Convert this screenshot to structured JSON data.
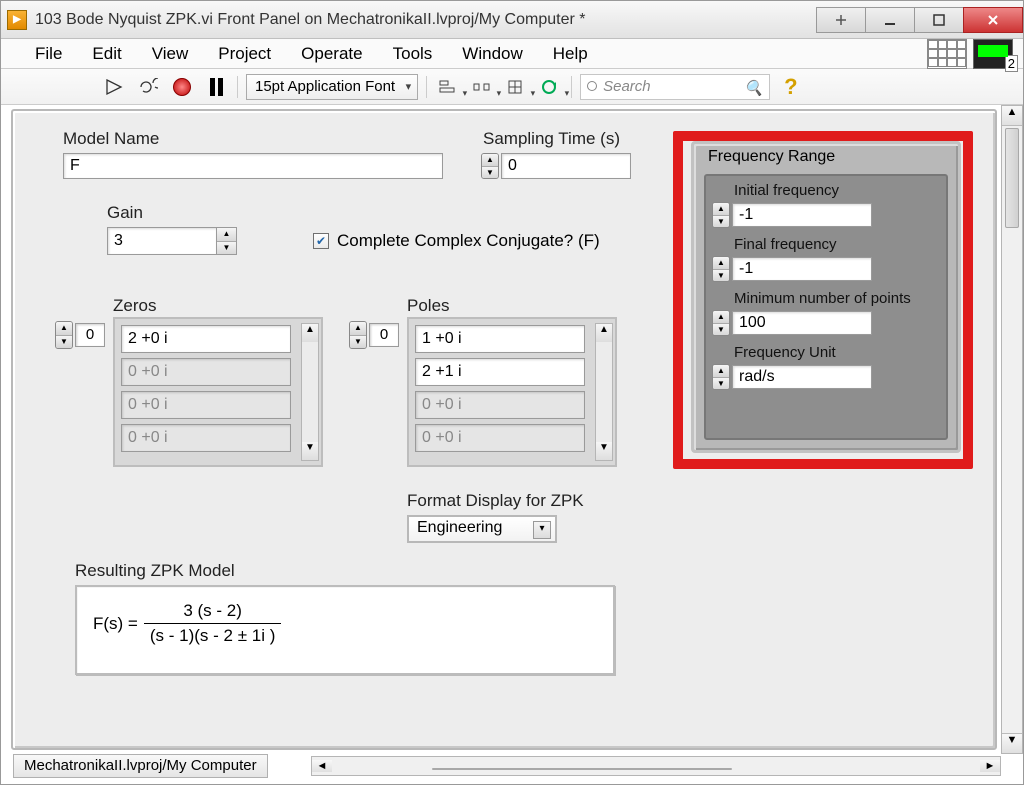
{
  "window_title": "103 Bode Nyquist ZPK.vi Front Panel on MechatronikaII.lvproj/My Computer *",
  "menu": [
    "File",
    "Edit",
    "View",
    "Project",
    "Operate",
    "Tools",
    "Window",
    "Help"
  ],
  "font_selector": "15pt Application Font",
  "search_placeholder": "Search",
  "panel": {
    "model_name_label": "Model Name",
    "model_name_value": "F",
    "sampling_label": "Sampling Time (s)",
    "sampling_value": "0",
    "gain_label": "Gain",
    "gain_value": "3",
    "complete_conjugate_label": "Complete Complex Conjugate? (F)",
    "complete_conjugate_checked": true,
    "zeros_label": "Zeros",
    "zeros_index": "0",
    "zeros": [
      "2 +0 i",
      "0 +0 i",
      "0 +0 i",
      "0 +0 i"
    ],
    "poles_label": "Poles",
    "poles_index": "0",
    "poles": [
      "1 +0 i",
      "2 +1 i",
      "0 +0 i",
      "0 +0 i"
    ],
    "format_label": "Format Display for ZPK",
    "format_value": "Engineering",
    "resulting_label": "Resulting ZPK Model",
    "formula_lhs": "F(s) =",
    "formula_num": "3 (s - 2)",
    "formula_den": "(s - 1)(s - 2 ± 1i )"
  },
  "freq": {
    "title": "Frequency Range",
    "initial_label": "Initial frequency",
    "initial_value": "-1",
    "final_label": "Final frequency",
    "final_value": "-1",
    "minpts_label": "Minimum number of points",
    "minpts_value": "100",
    "unit_label": "Frequency Unit",
    "unit_value": "rad/s"
  },
  "status_tab": "MechatronikaII.lvproj/My Computer",
  "nav_two": "2"
}
